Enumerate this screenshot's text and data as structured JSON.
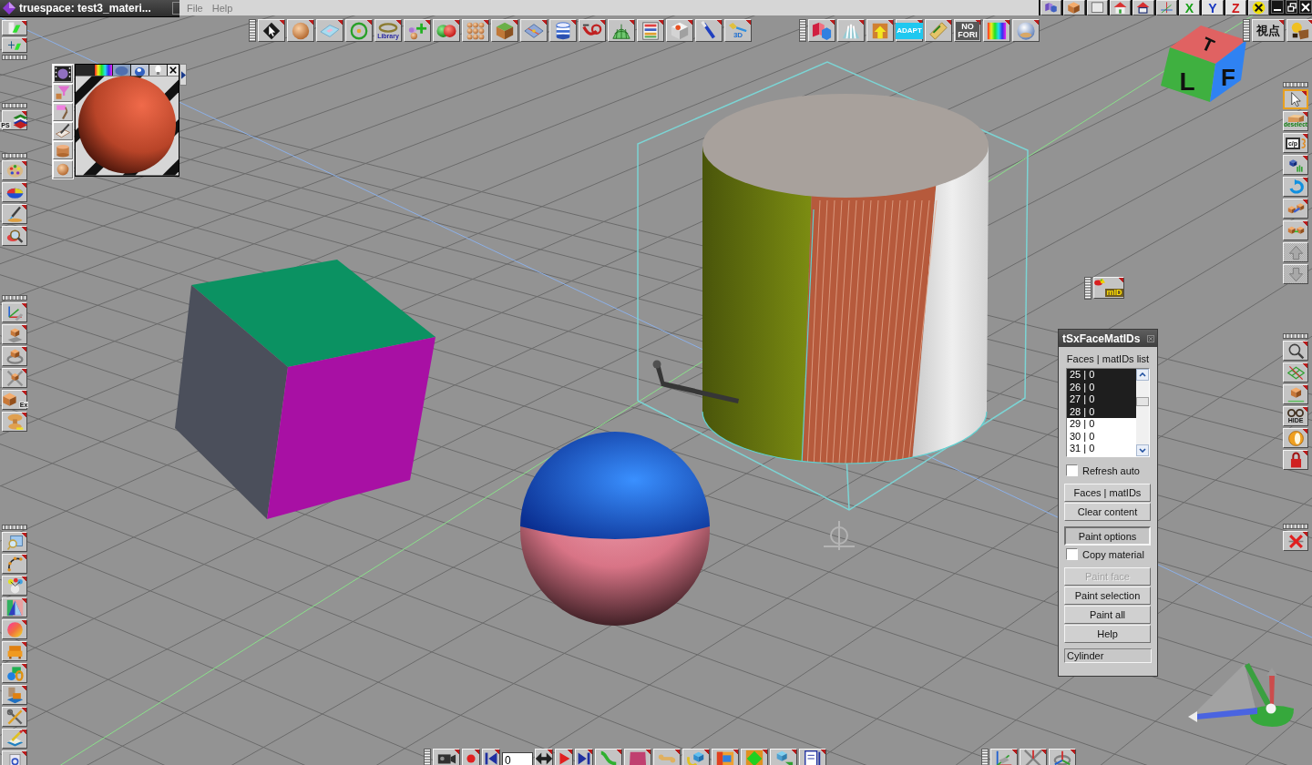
{
  "window": {
    "title": "truespace: test3_materi..."
  },
  "menu": [
    "File",
    "Help"
  ],
  "title_toolbar": {
    "axis_labels": [
      "X",
      "Y",
      "Z"
    ]
  },
  "main_toolbar": {
    "library_label": "Library",
    "plugin_label": "3D"
  },
  "render_toolbar": {
    "adapt_label": "ADAPT",
    "label_lines": [
      "NO",
      "FORI"
    ]
  },
  "view_toolbar": {
    "label": "視点"
  },
  "view_cube": {
    "top_face": "T",
    "left_face": "L",
    "right_face": "F"
  },
  "left_toolbar": {
    "layers_label": "PS",
    "explode_label": "Ex"
  },
  "right_toolbar": {
    "pointer_active": true,
    "deselect_label": "deselect",
    "clipboard_label": "c/p",
    "hide_label": "HIDE",
    "up_disabled": true,
    "down_disabled": true
  },
  "id_tool": {
    "label": "mID"
  },
  "timeline": {
    "frame": "0"
  },
  "face_mat_panel": {
    "title": "tSxFaceMatIDs",
    "list_caption": "Faces | matIDs list",
    "list": [
      {
        "text": "25 | 0",
        "selected": true
      },
      {
        "text": "26 | 0",
        "selected": true
      },
      {
        "text": "27 | 0",
        "selected": true
      },
      {
        "text": "28 | 0",
        "selected": true
      },
      {
        "text": "29 | 0",
        "selected": false
      },
      {
        "text": "30 | 0",
        "selected": false
      },
      {
        "text": "31 | 0",
        "selected": false
      }
    ],
    "groups": [
      [
        {
          "kind": "checkbox",
          "label": "Refresh auto",
          "checked": false
        }
      ],
      [
        {
          "kind": "button",
          "label": "Faces | matIDs",
          "disabled": false
        },
        {
          "kind": "button",
          "label": "Clear content",
          "disabled": false
        }
      ],
      [
        {
          "kind": "toggle",
          "label": "Paint options",
          "on": true
        },
        {
          "kind": "checkbox",
          "label": "Copy material",
          "checked": false
        }
      ],
      [
        {
          "kind": "button",
          "label": "Paint face",
          "disabled": true
        },
        {
          "kind": "button",
          "label": "Paint selection",
          "disabled": false
        },
        {
          "kind": "button",
          "label": "Paint all",
          "disabled": false
        },
        {
          "kind": "button",
          "label": "Help",
          "disabled": false
        }
      ]
    ],
    "status": "Cylinder"
  }
}
